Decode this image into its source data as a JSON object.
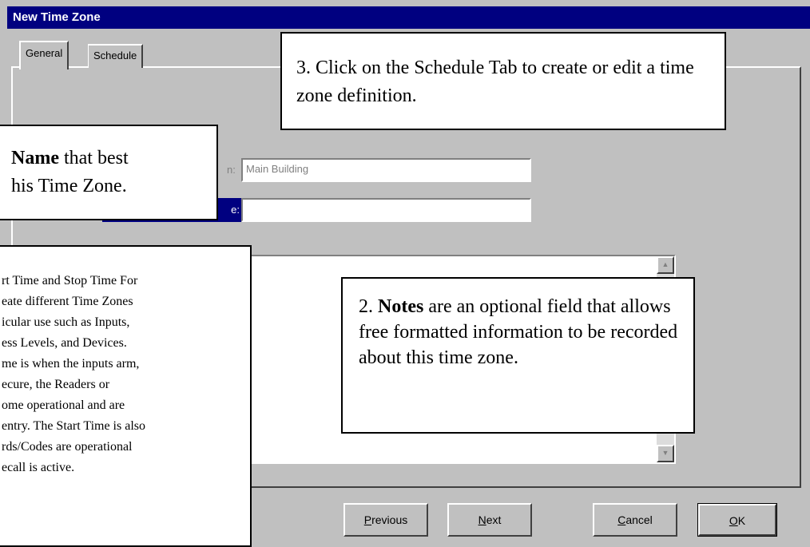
{
  "window": {
    "title": "New Time Zone"
  },
  "tabs": [
    {
      "label": "General"
    },
    {
      "label": "Schedule"
    }
  ],
  "form": {
    "description_label_partial": "n:",
    "description_value": "Main Building",
    "name_label_partial": "e:",
    "name_value": ""
  },
  "buttons": {
    "previous": {
      "hotkey": "P",
      "rest": "revious"
    },
    "next": {
      "hotkey": "N",
      "rest": "ext"
    },
    "cancel": {
      "hotkey": "C",
      "rest": "ancel"
    },
    "ok": {
      "hotkey": "O",
      "rest": "K"
    }
  },
  "callouts": {
    "c3": {
      "text": "3.  Click on the Schedule Tab to create or edit a time zone definition."
    },
    "c1": {
      "bold": "Name",
      "line1_rest": " that best",
      "line2": "his Time Zone."
    },
    "c2": {
      "prefix": "2.  ",
      "bold": "Notes",
      "rest": " are an optional field that allows free formatted information to be recorded about this time zone."
    },
    "c4": {
      "lines": [
        "rt Time and Stop Time For",
        "eate different Time Zones",
        "icular use such as Inputs,",
        "ess Levels, and Devices.",
        "me is when the inputs arm,",
        "ecure, the Readers or",
        "ome operational and are",
        "entry. The Start Time is also",
        "rds/Codes are operational",
        "ecall is active."
      ]
    }
  },
  "colors": {
    "titlebar": "#000080",
    "dialog_bg": "#c0c0c0"
  }
}
